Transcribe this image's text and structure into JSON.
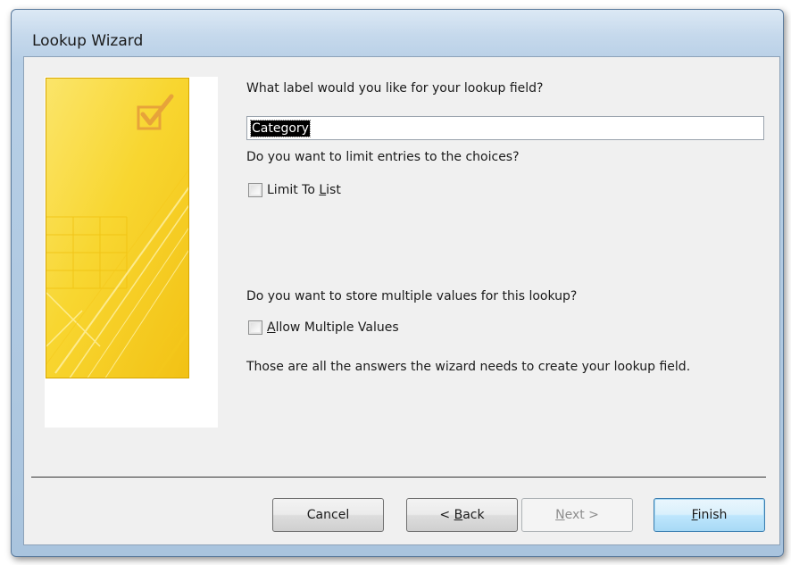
{
  "window": {
    "title": "Lookup Wizard"
  },
  "questions": {
    "label_question": "What label would you like for your lookup field?",
    "limit_question": "Do you want to limit entries to the choices?",
    "multi_question": "Do you want to store multiple values for this lookup?",
    "final_message": "Those are all the answers the wizard needs to create your lookup field."
  },
  "label_field": {
    "value": "Category"
  },
  "limit_to_list": {
    "pre": "Limit To ",
    "accel": "L",
    "post": "ist",
    "checked": false
  },
  "allow_multiple": {
    "pre": "",
    "accel": "A",
    "post": "llow Multiple Values",
    "checked": false
  },
  "buttons": {
    "cancel": {
      "label": "Cancel"
    },
    "back": {
      "pre": "< ",
      "accel": "B",
      "post": "ack"
    },
    "next": {
      "pre": "",
      "accel": "N",
      "post": "ext >",
      "disabled": true
    },
    "finish": {
      "pre": "",
      "accel": "F",
      "post": "inish"
    }
  },
  "colors": {
    "side_image_yellow": "#f7d42a",
    "side_image_highlight": "#fbe87a",
    "default_button_border": "#3c7fb1"
  },
  "icons": {
    "side_image": "wizard-banner-checkbox-icon"
  }
}
